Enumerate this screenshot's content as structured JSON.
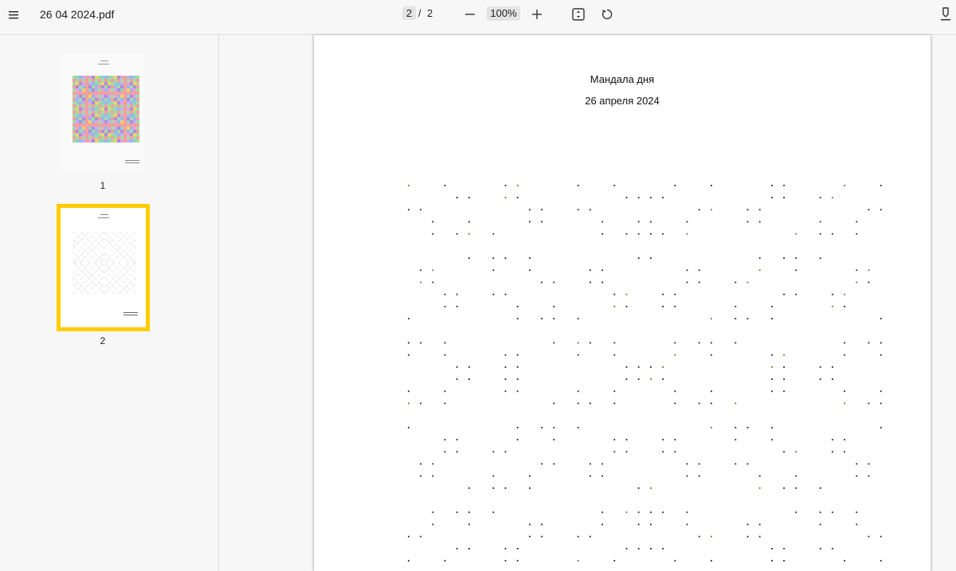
{
  "toolbar": {
    "file_name": "26 04 2024.pdf",
    "current_page": "2",
    "page_separator": "/",
    "total_pages": "2",
    "zoom": "100%",
    "icons": [
      "menu-icon",
      "minus-icon",
      "plus-icon",
      "fit-page-icon",
      "rotate-icon",
      "download-icon"
    ]
  },
  "sidebar": {
    "thumbnails": [
      {
        "label": "1",
        "selected": false
      },
      {
        "label": "2",
        "selected": true
      }
    ],
    "selection_color": "#ffcc00"
  },
  "document": {
    "title": "Мандала дня",
    "date": "26 апреля 2024"
  }
}
